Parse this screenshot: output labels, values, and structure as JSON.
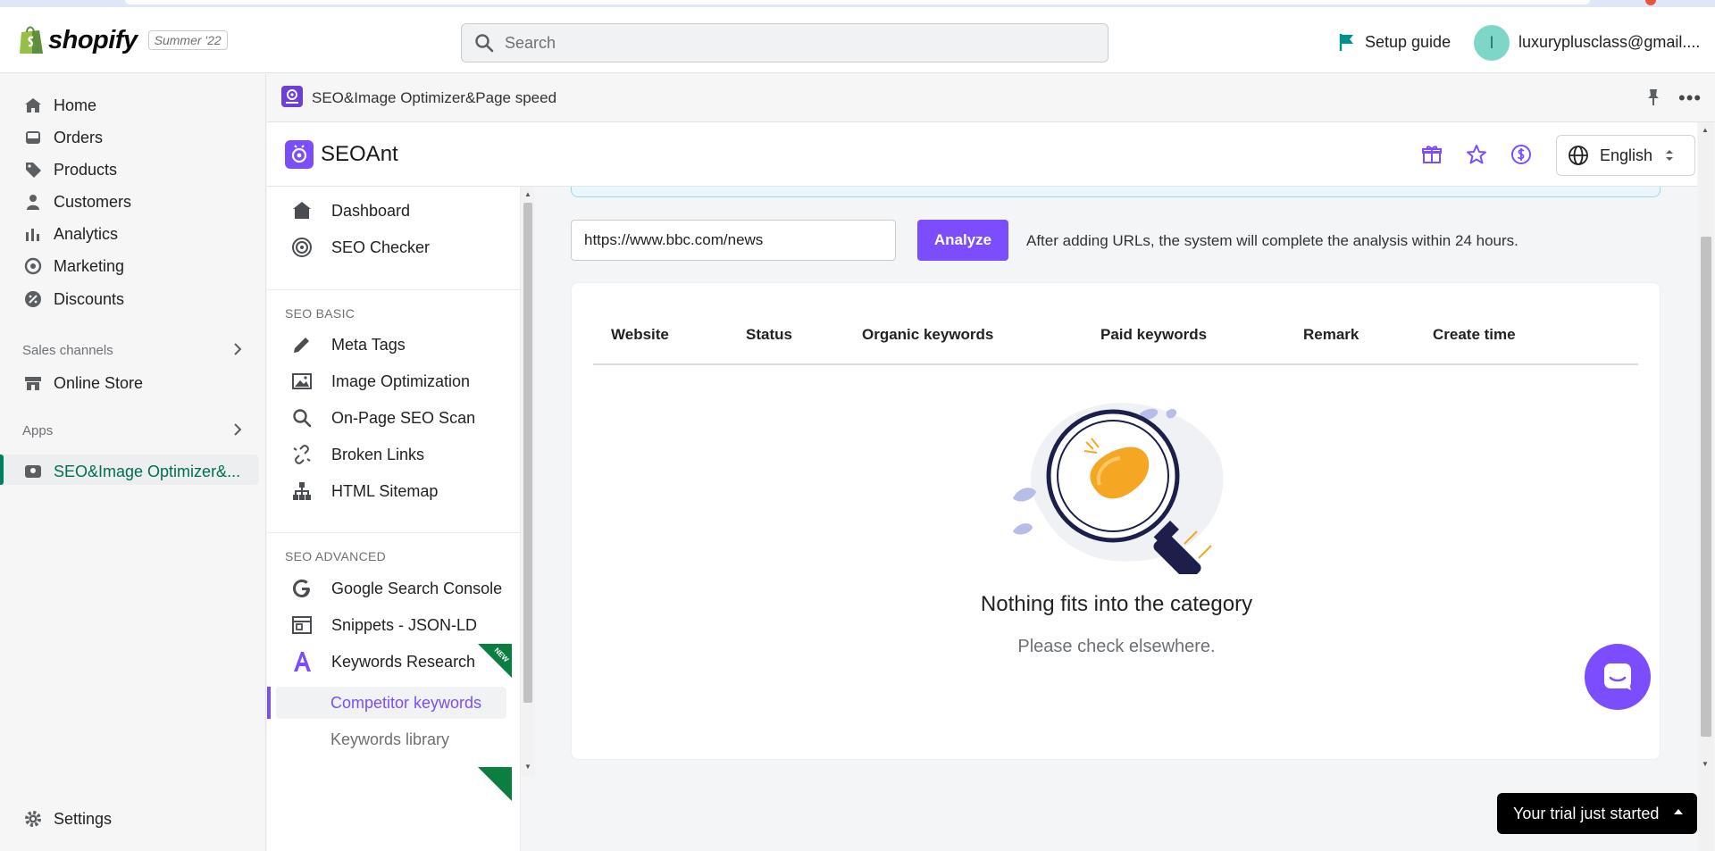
{
  "topbar": {
    "brand": "shopify",
    "edition": "Summer '22",
    "search_placeholder": "Search",
    "setup_guide": "Setup guide",
    "avatar_initial": "l",
    "account": "luxuryplusclass@gmail...."
  },
  "leftnav": {
    "items": [
      {
        "label": "Home",
        "icon": "home-icon"
      },
      {
        "label": "Orders",
        "icon": "inbox-icon"
      },
      {
        "label": "Products",
        "icon": "tag-icon"
      },
      {
        "label": "Customers",
        "icon": "person-icon"
      },
      {
        "label": "Analytics",
        "icon": "bar-chart-icon"
      },
      {
        "label": "Marketing",
        "icon": "target-icon"
      },
      {
        "label": "Discounts",
        "icon": "discount-icon"
      }
    ],
    "sales_channels": "Sales channels",
    "online_store": "Online Store",
    "apps": "Apps",
    "active_app": "SEO&Image Optimizer&...",
    "settings": "Settings",
    "accent_color": "#008060"
  },
  "app": {
    "title": "SEO&Image Optimizer&Page speed",
    "brand": "SEOAnt",
    "language": "English",
    "accent_color": "#7c4dff"
  },
  "sidebar": {
    "dashboard": "Dashboard",
    "seo_checker": "SEO Checker",
    "section_basic": "SEO BASIC",
    "meta_tags": "Meta Tags",
    "image_optimization": "Image Optimization",
    "onpage_scan": "On-Page SEO Scan",
    "broken_links": "Broken Links",
    "html_sitemap": "HTML Sitemap",
    "section_advanced": "SEO ADVANCED",
    "google_search_console": "Google Search Console",
    "snippets": "Snippets - JSON-LD",
    "keywords_research": "Keywords Research",
    "new_badge": "NEW",
    "competitor_keywords": "Competitor keywords",
    "keywords_library": "Keywords library"
  },
  "main": {
    "url_value": "https://www.bbc.com/news",
    "analyze_button": "Analyze",
    "hint": "After adding URLs, the system will complete the analysis within 24 hours.",
    "columns": [
      "Website",
      "Status",
      "Organic keywords",
      "Paid keywords",
      "Remark",
      "Create time"
    ],
    "empty_title": "Nothing fits into the category",
    "empty_subtitle": "Please check elsewhere."
  },
  "toast": {
    "trial": "Your trial just started"
  }
}
